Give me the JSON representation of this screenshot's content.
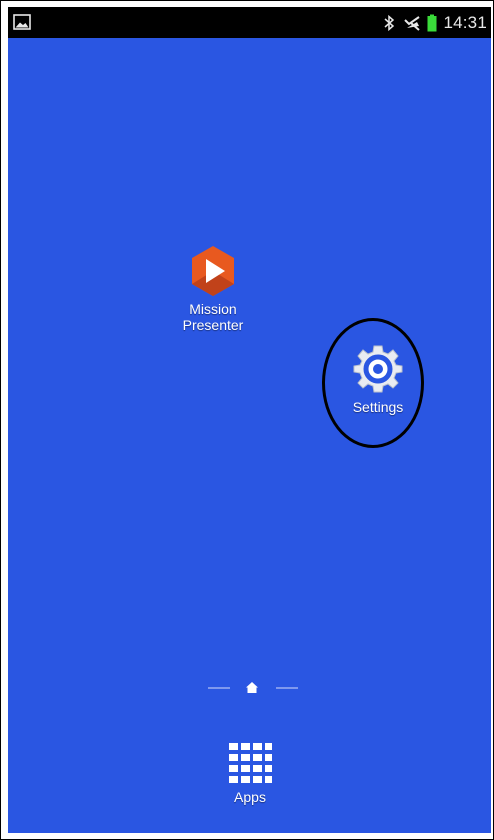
{
  "status_bar": {
    "left_icon": "gallery-notification-icon",
    "right_icons": [
      "bluetooth-icon",
      "mute-icon",
      "battery-icon"
    ],
    "battery_color": "#3adb3a",
    "time": "14:31"
  },
  "home_screen": {
    "background_color": "#2a56e2",
    "apps": [
      {
        "label": "Mission\nPresenter",
        "icon": "mission-presenter-icon"
      },
      {
        "label": "Settings",
        "icon": "settings-gear-icon"
      }
    ],
    "page_indicator": {
      "icon": "home-icon"
    }
  },
  "dock": {
    "apps_label": "Apps",
    "icon": "apps-grid-icon"
  }
}
